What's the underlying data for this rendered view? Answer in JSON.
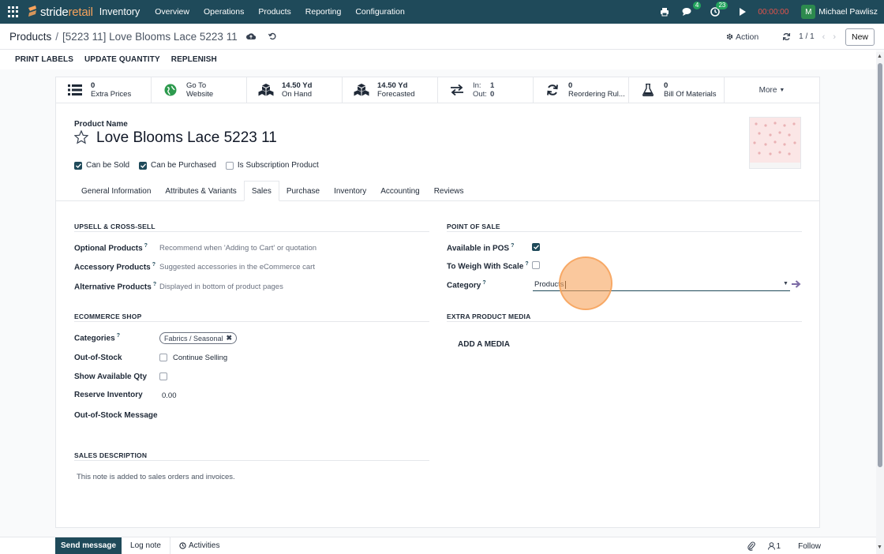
{
  "navbar": {
    "brand_part1": "stride",
    "brand_part2": "retail",
    "app_name": "Inventory",
    "menu": [
      "Overview",
      "Operations",
      "Products",
      "Reporting",
      "Configuration"
    ],
    "messages_badge": "4",
    "activities_badge": "23",
    "timer": "00:00:00",
    "user_initial": "M",
    "user_name": "Michael Pawlisz",
    "icons": [
      "apps-icon",
      "printer-icon",
      "chat-icon",
      "clock-icon",
      "play-icon"
    ]
  },
  "control": {
    "breadcrumb_parent": "Products",
    "breadcrumb_separator": "/",
    "breadcrumb_current": "[5223 11] Love Blooms Lace 5223 11",
    "action_label": "Action",
    "pager": "1 / 1",
    "new_label": "New"
  },
  "statusbar": {
    "buttons": [
      "PRINT LABELS",
      "UPDATE QUANTITY",
      "REPLENISH"
    ]
  },
  "smart_buttons": [
    {
      "value": "0",
      "label": "Extra Prices",
      "icon": "list-icon"
    },
    {
      "value": "Go To",
      "label": "Website",
      "icon": "globe-icon"
    },
    {
      "value": "14.50 Yd",
      "label": "On Hand",
      "icon": "cubes-icon"
    },
    {
      "value": "14.50 Yd",
      "label": "Forecasted",
      "icon": "cubes-icon"
    },
    {
      "in_label": "In:",
      "in_value": "1",
      "out_label": "Out:",
      "out_value": "0",
      "icon": "exchange-icon"
    },
    {
      "value": "0",
      "label": "Reordering Rul...",
      "icon": "refresh-icon"
    },
    {
      "value": "0",
      "label": "Bill Of Materials",
      "icon": "flask-icon"
    },
    {
      "label": "More"
    }
  ],
  "product": {
    "name_label": "Product Name",
    "name": "Love Blooms Lace 5223 11",
    "flags": [
      {
        "label": "Can be Sold",
        "checked": true
      },
      {
        "label": "Can be Purchased",
        "checked": true
      },
      {
        "label": "Is Subscription Product",
        "checked": false
      }
    ]
  },
  "tabs": [
    "General Information",
    "Attributes & Variants",
    "Sales",
    "Purchase",
    "Inventory",
    "Accounting",
    "Reviews"
  ],
  "active_tab": "Sales",
  "upsell": {
    "title": "UPSELL & CROSS-SELL",
    "fields": [
      {
        "label": "Optional Products",
        "placeholder": "Recommend when 'Adding to Cart' or quotation"
      },
      {
        "label": "Accessory Products",
        "placeholder": "Suggested accessories in the eCommerce cart"
      },
      {
        "label": "Alternative Products",
        "placeholder": "Displayed in bottom of product pages"
      }
    ]
  },
  "pos": {
    "title": "POINT OF SALE",
    "available_label": "Available in POS",
    "available_checked": true,
    "weigh_label": "To Weigh With Scale",
    "weigh_checked": false,
    "category_label": "Category",
    "category_value": "Products"
  },
  "ecommerce": {
    "title": "ECOMMERCE SHOP",
    "categories_label": "Categories",
    "category_tag": "Fabrics / Seasonal",
    "oos_label": "Out-of-Stock",
    "continue_selling": "Continue Selling",
    "show_qty_label": "Show Available Qty",
    "reserve_label": "Reserve Inventory",
    "reserve_value": "0.00",
    "oos_message_label": "Out-of-Stock Message"
  },
  "media": {
    "title": "EXTRA PRODUCT MEDIA",
    "add_label": "ADD A MEDIA"
  },
  "sales_desc": {
    "title": "SALES DESCRIPTION",
    "placeholder": "This note is added to sales orders and invoices."
  },
  "chatter": {
    "send_label": "Send message",
    "log_label": "Log note",
    "activities_label": "Activities",
    "followers_count": "1",
    "follow_label": "Follow"
  },
  "colors": {
    "navbar": "#1f4a5a",
    "brand_accent": "#f7a35c",
    "badge": "#23a45d",
    "timer": "#e5534b"
  }
}
